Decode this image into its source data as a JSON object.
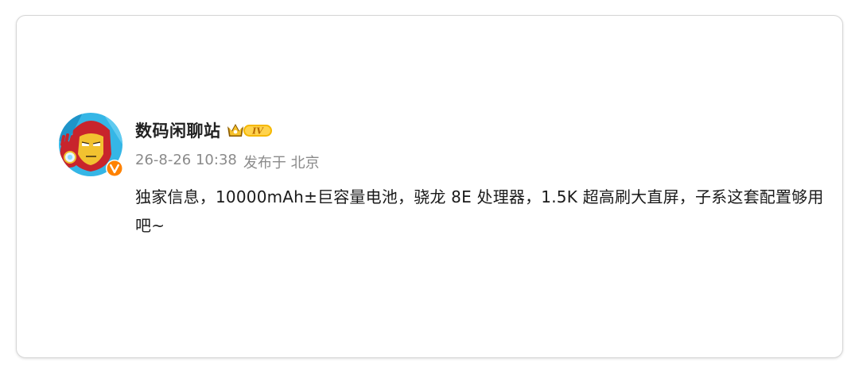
{
  "post": {
    "author": {
      "name": "数码闲聊站",
      "avatar_icon": "iron-man-avatar-icon",
      "verified_icon": "verified-v-icon",
      "level_badge_text": "IV",
      "level_badge_icon": "crown-icon"
    },
    "timestamp": "26-8-26 10:38",
    "source": "发布于 北京",
    "content": "独家信息，10000mAh±巨容量电池，骁龙 8E 处理器，1.5K 超高刷大直屏，子系这套配置够用吧~"
  },
  "colors": {
    "username": "#222222",
    "meta": "#8a8a8a",
    "content": "#1a1a1a",
    "card_border": "#d6d6d6",
    "verified_badge": "#ff8200",
    "level_badge": "#f5b800"
  }
}
